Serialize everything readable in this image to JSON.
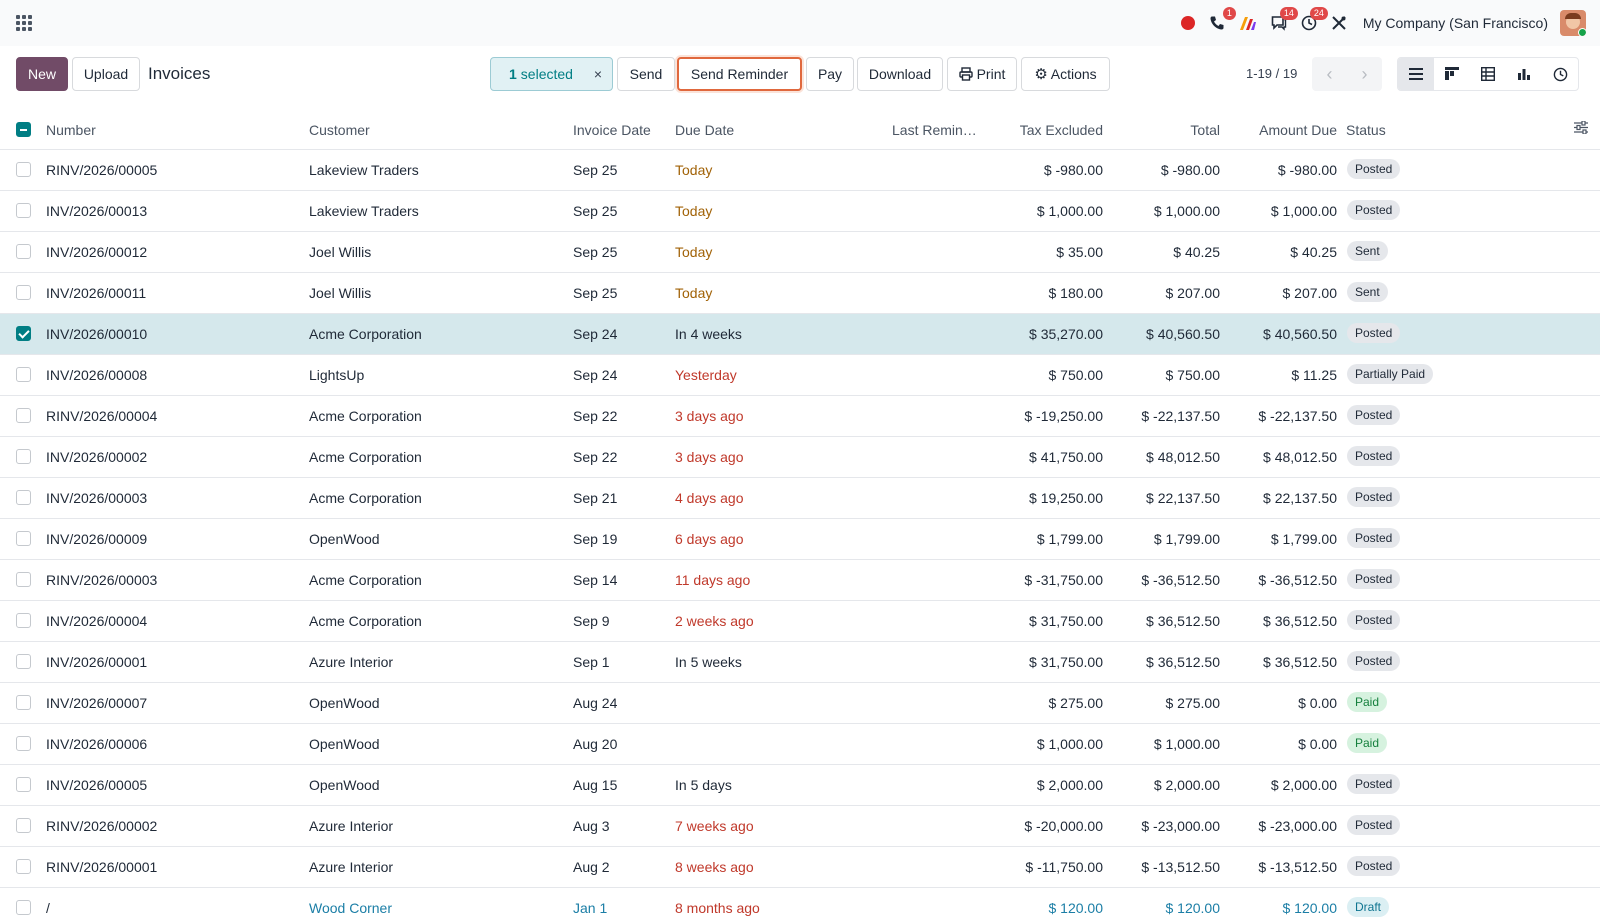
{
  "navbar": {
    "company": "My Company (San Francisco)",
    "badges": {
      "calls": "1",
      "messages": "14",
      "activities": "24"
    }
  },
  "control": {
    "new_label": "New",
    "upload_label": "Upload",
    "title": "Invoices",
    "selected_count": "1",
    "selected_label": "selected",
    "clear_icon": "×",
    "send_label": "Send",
    "send_reminder_label": "Send Reminder",
    "pay_label": "Pay",
    "download_label": "Download",
    "print_label": "Print",
    "actions_label": "Actions",
    "pager": "1-19 / 19"
  },
  "columns": {
    "number": "Number",
    "customer": "Customer",
    "invoice_date": "Invoice Date",
    "due_date": "Due Date",
    "last_reminder": "Last Remin…",
    "tax_excluded": "Tax Excluded",
    "total": "Total",
    "amount_due": "Amount Due",
    "status": "Status"
  },
  "rows": [
    {
      "number": "RINV/2026/00005",
      "customer": "Lakeview Traders",
      "invoice_date": "Sep 25",
      "due": "Today",
      "due_style": "warn",
      "tax_excluded": "$ -980.00",
      "total": "$ -980.00",
      "amount_due": "$ -980.00",
      "status": "Posted",
      "selected": false,
      "draft": false
    },
    {
      "number": "INV/2026/00013",
      "customer": "Lakeview Traders",
      "invoice_date": "Sep 25",
      "due": "Today",
      "due_style": "warn",
      "tax_excluded": "$ 1,000.00",
      "total": "$ 1,000.00",
      "amount_due": "$ 1,000.00",
      "status": "Posted",
      "selected": false,
      "draft": false
    },
    {
      "number": "INV/2026/00012",
      "customer": "Joel Willis",
      "invoice_date": "Sep 25",
      "due": "Today",
      "due_style": "warn",
      "tax_excluded": "$ 35.00",
      "total": "$ 40.25",
      "amount_due": "$ 40.25",
      "status": "Sent",
      "selected": false,
      "draft": false
    },
    {
      "number": "INV/2026/00011",
      "customer": "Joel Willis",
      "invoice_date": "Sep 25",
      "due": "Today",
      "due_style": "warn",
      "tax_excluded": "$ 180.00",
      "total": "$ 207.00",
      "amount_due": "$ 207.00",
      "status": "Sent",
      "selected": false,
      "draft": false
    },
    {
      "number": "INV/2026/00010",
      "customer": "Acme Corporation",
      "invoice_date": "Sep 24",
      "due": "In 4 weeks",
      "due_style": "normal",
      "tax_excluded": "$ 35,270.00",
      "total": "$ 40,560.50",
      "amount_due": "$ 40,560.50",
      "status": "Posted",
      "selected": true,
      "draft": false
    },
    {
      "number": "INV/2026/00008",
      "customer": "LightsUp",
      "invoice_date": "Sep 24",
      "due": "Yesterday",
      "due_style": "late",
      "tax_excluded": "$ 750.00",
      "total": "$ 750.00",
      "amount_due": "$ 11.25",
      "status": "Partially Paid",
      "selected": false,
      "draft": false
    },
    {
      "number": "RINV/2026/00004",
      "customer": "Acme Corporation",
      "invoice_date": "Sep 22",
      "due": "3 days ago",
      "due_style": "late",
      "tax_excluded": "$ -19,250.00",
      "total": "$ -22,137.50",
      "amount_due": "$ -22,137.50",
      "status": "Posted",
      "selected": false,
      "draft": false
    },
    {
      "number": "INV/2026/00002",
      "customer": "Acme Corporation",
      "invoice_date": "Sep 22",
      "due": "3 days ago",
      "due_style": "late",
      "tax_excluded": "$ 41,750.00",
      "total": "$ 48,012.50",
      "amount_due": "$ 48,012.50",
      "status": "Posted",
      "selected": false,
      "draft": false
    },
    {
      "number": "INV/2026/00003",
      "customer": "Acme Corporation",
      "invoice_date": "Sep 21",
      "due": "4 days ago",
      "due_style": "late",
      "tax_excluded": "$ 19,250.00",
      "total": "$ 22,137.50",
      "amount_due": "$ 22,137.50",
      "status": "Posted",
      "selected": false,
      "draft": false
    },
    {
      "number": "INV/2026/00009",
      "customer": "OpenWood",
      "invoice_date": "Sep 19",
      "due": "6 days ago",
      "due_style": "late",
      "tax_excluded": "$ 1,799.00",
      "total": "$ 1,799.00",
      "amount_due": "$ 1,799.00",
      "status": "Posted",
      "selected": false,
      "draft": false
    },
    {
      "number": "RINV/2026/00003",
      "customer": "Acme Corporation",
      "invoice_date": "Sep 14",
      "due": "11 days ago",
      "due_style": "late",
      "tax_excluded": "$ -31,750.00",
      "total": "$ -36,512.50",
      "amount_due": "$ -36,512.50",
      "status": "Posted",
      "selected": false,
      "draft": false
    },
    {
      "number": "INV/2026/00004",
      "customer": "Acme Corporation",
      "invoice_date": "Sep 9",
      "due": "2 weeks ago",
      "due_style": "late",
      "tax_excluded": "$ 31,750.00",
      "total": "$ 36,512.50",
      "amount_due": "$ 36,512.50",
      "status": "Posted",
      "selected": false,
      "draft": false
    },
    {
      "number": "INV/2026/00001",
      "customer": "Azure Interior",
      "invoice_date": "Sep 1",
      "due": "In 5 weeks",
      "due_style": "normal",
      "tax_excluded": "$ 31,750.00",
      "total": "$ 36,512.50",
      "amount_due": "$ 36,512.50",
      "status": "Posted",
      "selected": false,
      "draft": false
    },
    {
      "number": "INV/2026/00007",
      "customer": "OpenWood",
      "invoice_date": "Aug 24",
      "due": "",
      "due_style": "normal",
      "tax_excluded": "$ 275.00",
      "total": "$ 275.00",
      "amount_due": "$ 0.00",
      "status": "Paid",
      "selected": false,
      "draft": false
    },
    {
      "number": "INV/2026/00006",
      "customer": "OpenWood",
      "invoice_date": "Aug 20",
      "due": "",
      "due_style": "normal",
      "tax_excluded": "$ 1,000.00",
      "total": "$ 1,000.00",
      "amount_due": "$ 0.00",
      "status": "Paid",
      "selected": false,
      "draft": false
    },
    {
      "number": "INV/2026/00005",
      "customer": "OpenWood",
      "invoice_date": "Aug 15",
      "due": "In 5 days",
      "due_style": "normal",
      "tax_excluded": "$ 2,000.00",
      "total": "$ 2,000.00",
      "amount_due": "$ 2,000.00",
      "status": "Posted",
      "selected": false,
      "draft": false
    },
    {
      "number": "RINV/2026/00002",
      "customer": "Azure Interior",
      "invoice_date": "Aug 3",
      "due": "7 weeks ago",
      "due_style": "late",
      "tax_excluded": "$ -20,000.00",
      "total": "$ -23,000.00",
      "amount_due": "$ -23,000.00",
      "status": "Posted",
      "selected": false,
      "draft": false
    },
    {
      "number": "RINV/2026/00001",
      "customer": "Azure Interior",
      "invoice_date": "Aug 2",
      "due": "8 weeks ago",
      "due_style": "late",
      "tax_excluded": "$ -11,750.00",
      "total": "$ -13,512.50",
      "amount_due": "$ -13,512.50",
      "status": "Posted",
      "selected": false,
      "draft": false
    },
    {
      "number": "/",
      "customer": "Wood Corner",
      "invoice_date": "Jan 1",
      "due": "8 months ago",
      "due_style": "late",
      "tax_excluded": "$ 120.00",
      "total": "$ 120.00",
      "amount_due": "$ 120.00",
      "status": "Draft",
      "selected": false,
      "draft": true
    }
  ],
  "colors": {
    "brand": "#714b67",
    "accent": "#017e84",
    "highlight_border": "#e0683d",
    "overdue": "#c0392b",
    "due_today": "#a16207"
  },
  "icons": [
    "apps-grid-icon",
    "recording-icon",
    "phone-icon",
    "ai-icon",
    "chat-icon",
    "clock-icon",
    "tools-icon",
    "print-icon",
    "gear-icon",
    "chevron-left-icon",
    "chevron-right-icon",
    "list-view-icon",
    "kanban-view-icon",
    "pivot-view-icon",
    "graph-view-icon",
    "activity-view-icon",
    "column-settings-icon"
  ]
}
